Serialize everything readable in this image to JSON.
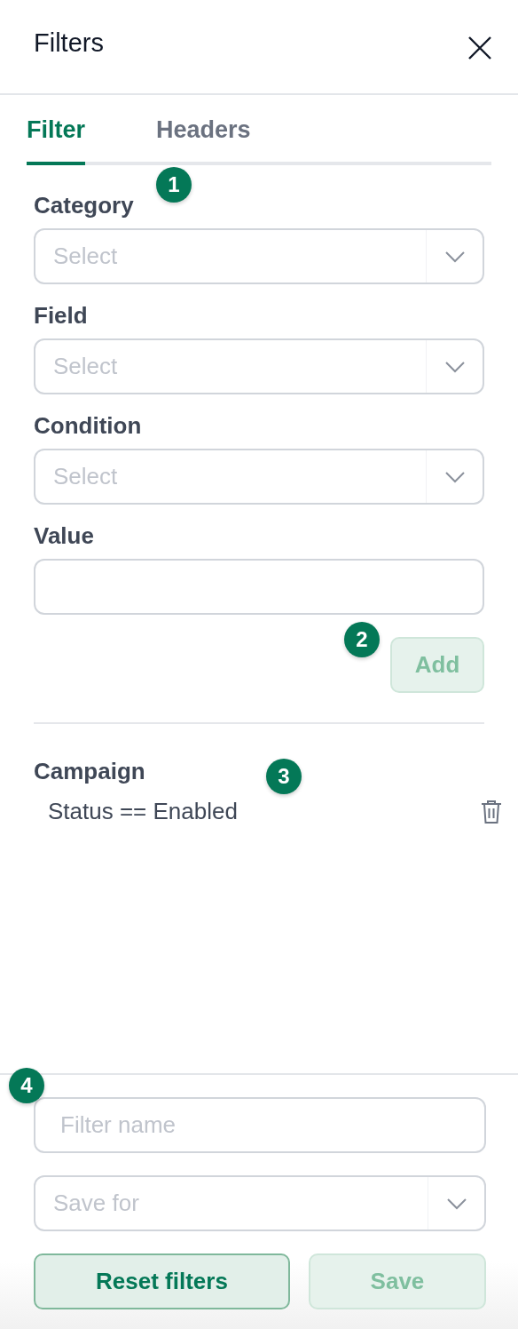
{
  "header": {
    "title": "Filters"
  },
  "tabs": [
    {
      "label": "Filter",
      "selected": true
    },
    {
      "label": "Headers",
      "selected": false
    }
  ],
  "fields": [
    {
      "kind": "select",
      "label": "Category",
      "placeholder": "Select",
      "marker": "1"
    },
    {
      "kind": "select",
      "label": "Field",
      "placeholder": "Select"
    },
    {
      "kind": "select",
      "label": "Condition",
      "placeholder": "Select"
    },
    {
      "kind": "input",
      "label": "Value"
    }
  ],
  "add_button": {
    "label": "Add",
    "disabled": true,
    "marker": "2"
  },
  "filter_groups": [
    {
      "title": "Campaign",
      "rules": [
        {
          "text": "Status == Enabled",
          "marker": "3"
        }
      ]
    }
  ],
  "footer": {
    "marker": "4",
    "fields": [
      {
        "kind": "input",
        "placeholder": "Filter name"
      },
      {
        "kind": "select",
        "placeholder": "Save for"
      }
    ],
    "buttons": [
      {
        "label": "Reset filters",
        "disabled": false
      },
      {
        "label": "Save",
        "disabled": true
      }
    ]
  }
}
